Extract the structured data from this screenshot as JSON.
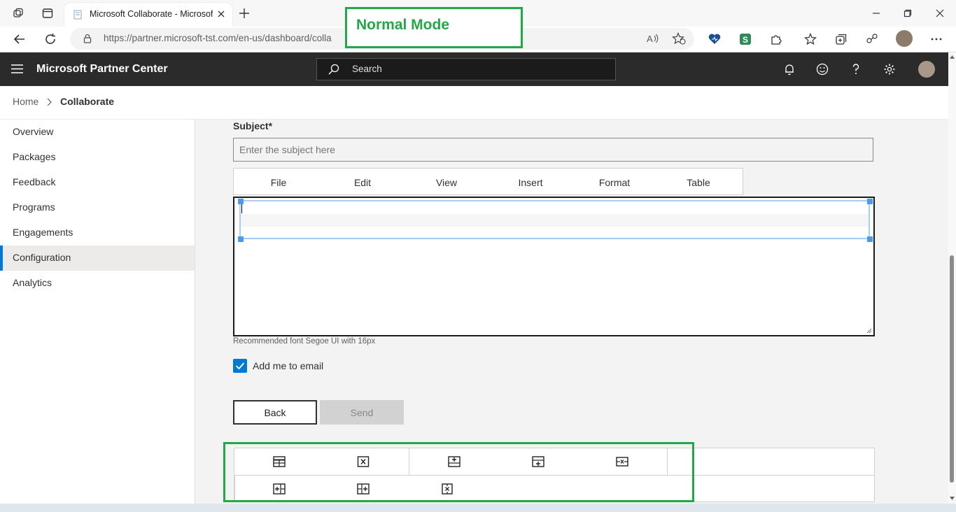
{
  "browser": {
    "tab_title": "Microsoft Collaborate - Microsoft",
    "url": "https://partner.microsoft-tst.com/en-us/dashboard/colla"
  },
  "app": {
    "title": "Microsoft Partner Center",
    "search_placeholder": "Search"
  },
  "breadcrumb": {
    "home": "Home",
    "current": "Collaborate"
  },
  "sidebar": {
    "items": [
      {
        "label": "Overview"
      },
      {
        "label": "Packages"
      },
      {
        "label": "Feedback"
      },
      {
        "label": "Programs"
      },
      {
        "label": "Engagements"
      },
      {
        "label": "Configuration",
        "active": true
      },
      {
        "label": "Analytics"
      }
    ]
  },
  "form": {
    "subject_label": "Subject",
    "required_mark": "*",
    "subject_placeholder": "Enter the subject here",
    "menu": [
      "File",
      "Edit",
      "View",
      "Insert",
      "Format",
      "Table"
    ],
    "font_hint": "Recommended font Segoe UI with 16px",
    "add_me_label": "Add me to email",
    "add_me_checked": true,
    "back_label": "Back",
    "send_label": "Send"
  },
  "table_toolbar": {
    "row1_icons": [
      "table-properties-icon",
      "delete-table-icon",
      "insert-row-before-icon",
      "insert-row-after-icon",
      "delete-row-icon"
    ],
    "row2_icons": [
      "insert-column-before-icon",
      "insert-column-after-icon",
      "delete-column-icon"
    ]
  },
  "annotation": {
    "text": "Normal Mode",
    "color": "#22a846"
  },
  "colors": {
    "accent": "#0078d4",
    "header_bg": "#2b2b2b"
  }
}
